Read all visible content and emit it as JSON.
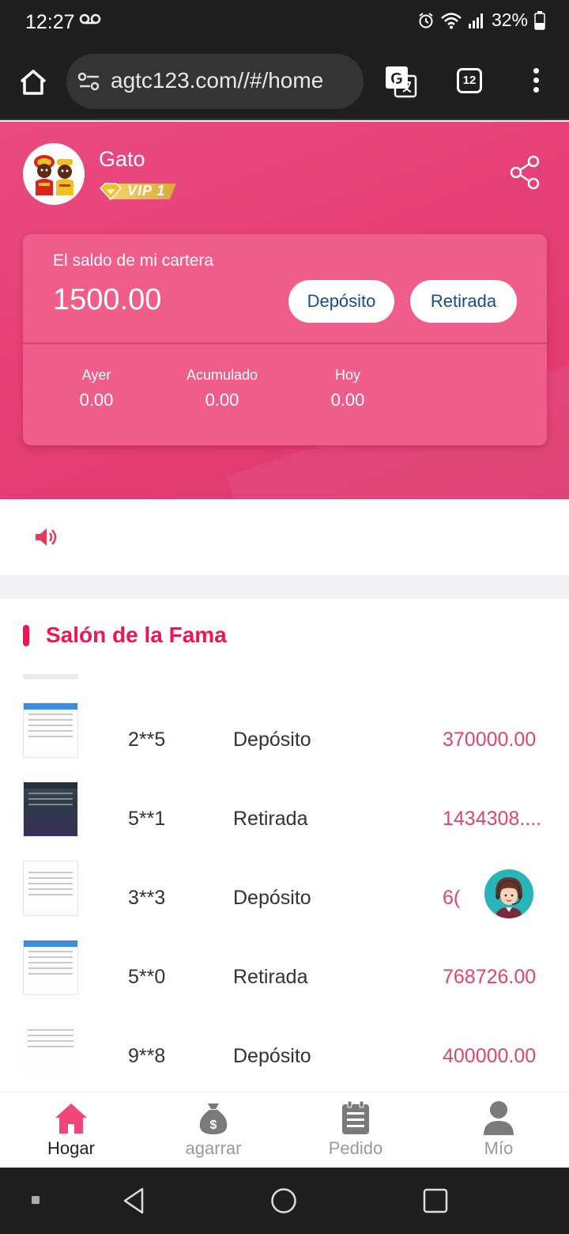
{
  "status_bar": {
    "time": "12:27",
    "battery": "32%",
    "icons": [
      "voicemail-icon",
      "alarm-icon",
      "wifi-icon",
      "signal-icon",
      "battery-icon"
    ]
  },
  "browser": {
    "url": "agtc123.com//#/home",
    "tab_count": "12",
    "icons": [
      "home-icon",
      "site-settings-icon",
      "translate-icon",
      "tabs-icon",
      "more-menu-icon"
    ]
  },
  "profile": {
    "username": "Gato",
    "vip": "VIP 1"
  },
  "wallet": {
    "label": "El saldo de mi cartera",
    "balance": "1500.00",
    "deposit_label": "Depósito",
    "withdraw_label": "Retirada",
    "stats": [
      {
        "label": "Ayer",
        "value": "0.00"
      },
      {
        "label": "Acumulado",
        "value": "0.00"
      },
      {
        "label": "Hoy",
        "value": "0.00"
      }
    ]
  },
  "hall_of_fame": {
    "title": "Salón de la Fama",
    "rows": [
      {
        "user": "2**5",
        "type": "Depósito",
        "amount": "370000.00"
      },
      {
        "user": "5**1",
        "type": "Retirada",
        "amount": "1434308...."
      },
      {
        "user": "3**3",
        "type": "Depósito",
        "amount": "6("
      },
      {
        "user": "5**0",
        "type": "Retirada",
        "amount": "768726.00"
      },
      {
        "user": "9**8",
        "type": "Depósito",
        "amount": "400000.00"
      }
    ]
  },
  "bottom_nav": [
    {
      "label": "Hogar",
      "icon": "home-icon",
      "active": true
    },
    {
      "label": "agarrar",
      "icon": "money-bag-icon",
      "active": false
    },
    {
      "label": "Pedido",
      "icon": "clipboard-icon",
      "active": false
    },
    {
      "label": "Mío",
      "icon": "user-icon",
      "active": false
    }
  ],
  "colors": {
    "brand_pink": "#e33d74",
    "card_pink": "#f05d8a",
    "accent_red": "#f2134f",
    "amount_pink": "#e0456e",
    "button_text_blue": "#1b4a8a"
  }
}
